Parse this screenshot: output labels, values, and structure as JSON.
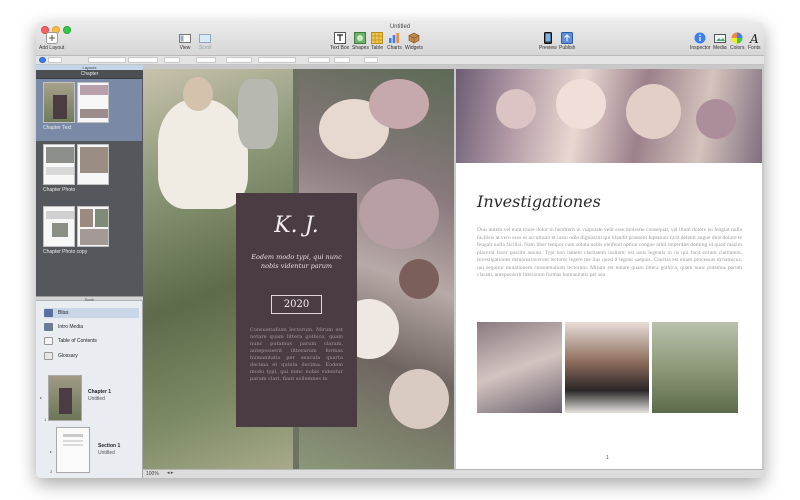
{
  "window": {
    "title": "Untitled"
  },
  "toolbar": {
    "add_layout": "Add Layout",
    "view": "View",
    "scroll": "Scroll",
    "text_box": "Text Box",
    "shapes": "Shapes",
    "table": "Table",
    "charts": "Charts",
    "widgets": "Widgets",
    "preview": "Preview",
    "publish": "Publish",
    "inspector": "Inspector",
    "media": "Media",
    "colors": "Colors",
    "fonts": "Fonts"
  },
  "sidebar": {
    "layouts_header": "Layouts",
    "layout_panel_title": "Chapter",
    "layouts": [
      {
        "label": "Chapter Text"
      },
      {
        "label": "Chapter Photo"
      },
      {
        "label": "Chapter Photo copy"
      }
    ],
    "book_header": "Book",
    "book_items": [
      {
        "label": "Bliss",
        "icon": "book-icon"
      },
      {
        "label": "Intro Media",
        "icon": "media-icon"
      },
      {
        "label": "Table of Contents",
        "icon": "toc-icon"
      },
      {
        "label": "Glossary",
        "icon": "glossary-icon"
      }
    ],
    "chapters": [
      {
        "number": "1",
        "title": "Chapter 1",
        "subtitle": "Untitled"
      },
      {
        "number": "2",
        "title": "Section 1",
        "subtitle": "Untitled"
      }
    ]
  },
  "left_page": {
    "initials": "K. J.",
    "tagline": "Eodem modo typi, qui nunc nobis videntur parum",
    "year": "2020",
    "body": "Consuetudium lectorum. Mirum est notare quam littera gothica, quam nunc putamus parum claram, anteposuerit litterarum formas humanitatis per seacula quarta decima et quinta decima. Eodem modo typi, qui nunc nobis videntur parum clari, fiant sollemnes in"
  },
  "right_page": {
    "title": "Investigationes",
    "body": "Duis autem vel eum iriure dolor in hendrerit in vulputate velit esse molestie consequat, vel illum dolore eu feugiat nulla facilisis at vero eros et accumsan et iusto odio dignissim qui blandit praesent luptatum zzril delenit augue duis dolore te feugait nulla facilisi. Nam liber tempor cum soluta nobis eleifend option congue nihil imperdiet doming id quod mazim placerat facer possim assum. Typi non habent claritatem insitam; est usus legentis in iis qui facit eorum claritatem. Investigationes demonstraverunt lectores legere me lius quod ii legunt saepius. Claritas est etiam processus dynamicus, qui sequitur mutationem consuetudium lectorum. Mirum est notare quam littera gothica, quam nunc putamus parum claram, anteposuerit litterarum formas humanitatis per sea",
    "page_number": "1"
  },
  "status": {
    "zoom": "100%"
  },
  "colors": {
    "overlay": "#4b3c44",
    "sidebar_dark": "#54575b",
    "selection": "#7a8aa6",
    "accent_blue": "#3b7ff0"
  }
}
